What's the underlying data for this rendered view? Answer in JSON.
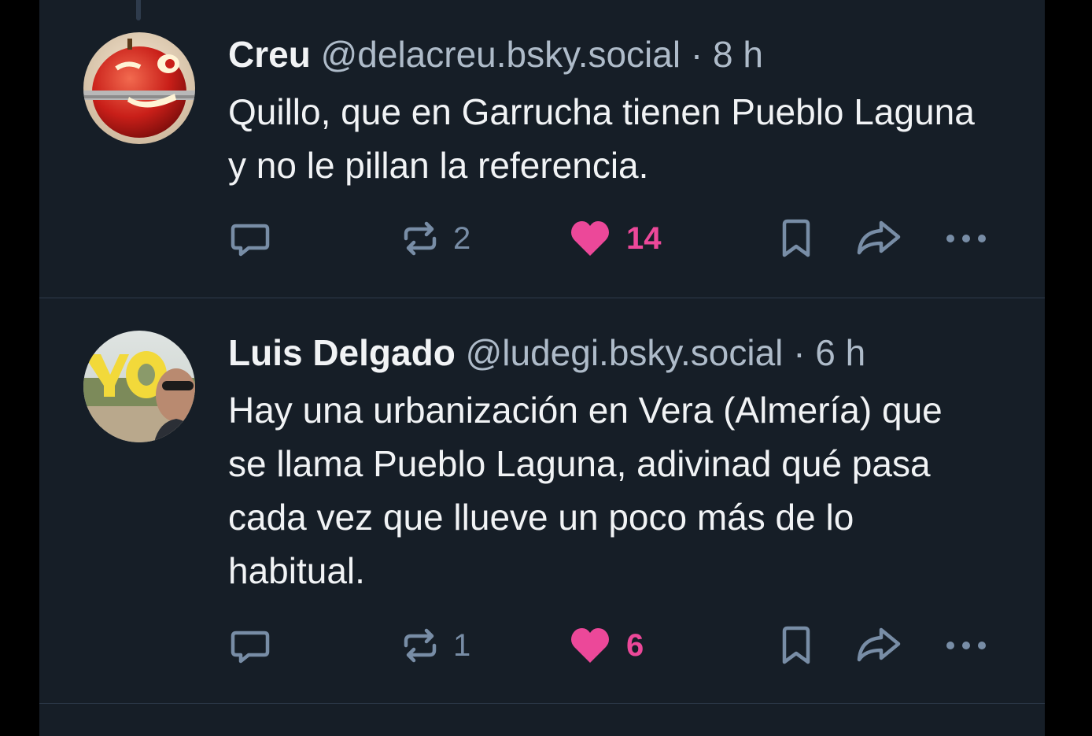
{
  "posts": [
    {
      "author_name": "Creu",
      "handle": "@delacreu.bsky.social",
      "separator": "·",
      "time": "8 h",
      "text": "Quillo, que en Garrucha tienen Pueblo Laguna y no le pillan la referencia.",
      "repost_count": "2",
      "like_count": "14",
      "liked": true
    },
    {
      "author_name": "Luis Delgado",
      "handle": "@ludegi.bsky.social",
      "separator": "·",
      "time": "6 h",
      "text": "Hay una urbanización en Vera (Almería) que se llama Pueblo Laguna, adivinad qué pasa cada vez que llueve un poco más de lo habitual.",
      "repost_count": "1",
      "like_count": "6",
      "liked": true
    }
  ],
  "colors": {
    "background": "#161e27",
    "text": "#f1f3f5",
    "muted": "#aebbc9",
    "icon": "#788da6",
    "like": "#ec4899"
  },
  "icons": {
    "reply": "speech-bubble-icon",
    "repost": "repost-arrows-icon",
    "like": "heart-icon",
    "bookmark": "bookmark-icon",
    "share": "share-arrow-icon",
    "more": "ellipsis-icon"
  }
}
